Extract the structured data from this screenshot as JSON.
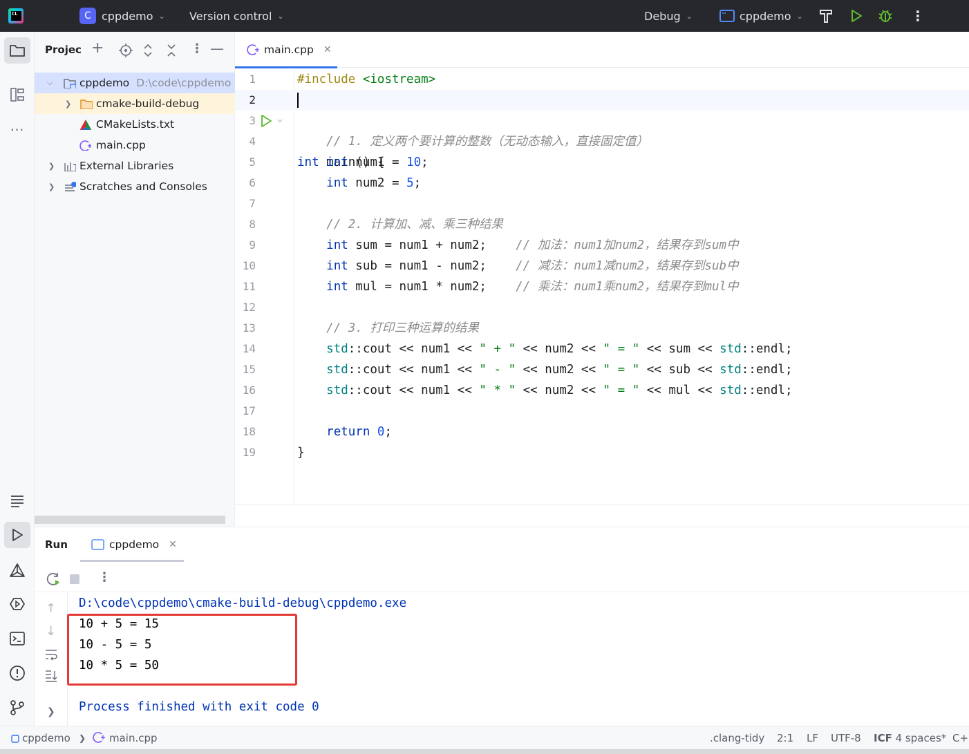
{
  "titlebar": {
    "project_badge": "C",
    "project_name": "cppdemo",
    "vcs": "Version control",
    "config": "Debug",
    "run_target": "cppdemo"
  },
  "project_panel": {
    "title": "Projec",
    "tree": [
      {
        "label": "cppdemo",
        "path": "D:\\code\\cppdemo",
        "icon": "module-folder-icon"
      },
      {
        "label": "cmake-build-debug",
        "icon": "folder-icon"
      },
      {
        "label": "CMakeLists.txt",
        "icon": "cmake-icon"
      },
      {
        "label": "main.cpp",
        "icon": "cpp-file-icon"
      },
      {
        "label": "External Libraries",
        "icon": "libraries-icon"
      },
      {
        "label": "Scratches and Consoles",
        "icon": "scratches-icon"
      }
    ]
  },
  "editor": {
    "tab": "main.cpp",
    "line_numbers": [
      "1",
      "2",
      "3",
      "4",
      "5",
      "6",
      "7",
      "8",
      "9",
      "10",
      "11",
      "12",
      "13",
      "14",
      "15",
      "16",
      "17",
      "18",
      "19"
    ],
    "comments": {
      "c1": "// 1. 定义两个要计算的整数（无动态输入，直接固定值）",
      "c2": "// 2. 计算加、减、乘三种结果",
      "c3": "// 加法：num1加num2，结果存到sum中",
      "c4": "// 减法：num1减num2，结果存到sub中",
      "c5": "// 乘法：num1乘num2，结果存到mul中",
      "c6": "// 3. 打印三种运算的结果"
    }
  },
  "run_panel": {
    "title": "Run",
    "tab": "cppdemo",
    "console": [
      "D:\\code\\cppdemo\\cmake-build-debug\\cppdemo.exe",
      "10 + 5 = 15",
      "10 - 5 = 5",
      "10 * 5 = 50",
      "",
      "Process finished with exit code 0"
    ]
  },
  "statusbar": {
    "crumb_project": "cppdemo",
    "crumb_file": "main.cpp",
    "linter": ".clang-tidy",
    "position": "2:1",
    "line_sep": "LF",
    "encoding": "UTF-8",
    "indent_prefix": "ICF",
    "indent": "4 spaces*",
    "lang": "C+"
  },
  "colors": {
    "accent": "#3574f0",
    "titlebar_bg": "#27282c",
    "keyword": "#0033b3",
    "string": "#067d17",
    "run_green": "#5fb832",
    "highlight_box": "#e53935"
  }
}
